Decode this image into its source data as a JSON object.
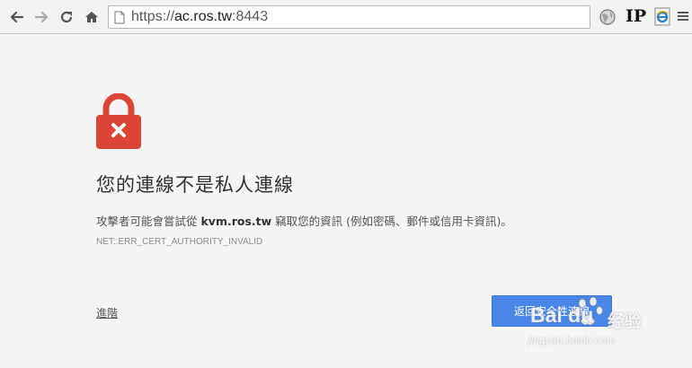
{
  "browser": {
    "url_scheme": "https://",
    "url_host": "ac.ros.tw",
    "url_port": ":8443",
    "ip_extension_label": "IP"
  },
  "interstitial": {
    "headline": "您的連線不是私人連線",
    "body_prefix": "攻擊者可能會嘗試從 ",
    "body_host": "kvm.ros.tw",
    "body_suffix": " 竊取您的資訊 (例如密碼、郵件或信用卡資訊)。",
    "error_code": "NET::ERR_CERT_AUTHORITY_INVALID",
    "advanced_label": "進階",
    "back_button_label": "返回安全性連線"
  },
  "watermark": {
    "brand": "Bai  du",
    "sub": "经验",
    "url": "jingyan.baidu.com"
  },
  "colors": {
    "lock_red": "#db4437",
    "button_blue": "#4a86e8"
  },
  "icons": [
    "back-arrow-icon",
    "forward-arrow-icon",
    "reload-icon",
    "home-icon",
    "page-icon",
    "globe-icon",
    "ie-icon",
    "menu-icon",
    "lock-error-icon"
  ]
}
